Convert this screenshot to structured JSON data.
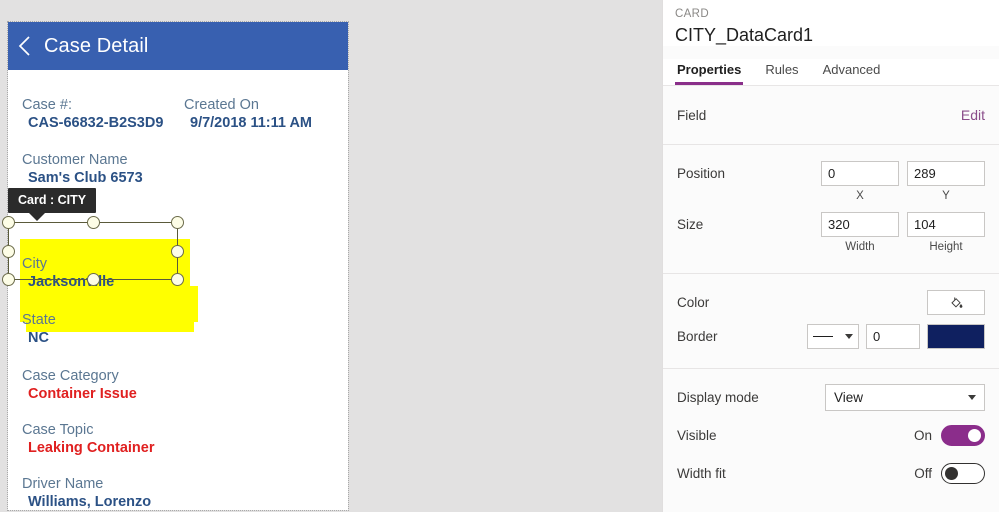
{
  "colors": {
    "header_blue": "#3860b0",
    "accent_purple": "#8a2f8a",
    "highlight_yellow": "#ffff00",
    "label_blue": "#5b7792",
    "value_blue": "#2b5185",
    "value_red": "#e02020",
    "border_swatch": "#0f2060"
  },
  "app": {
    "title": "Case Detail",
    "back_icon": "chevron-left-icon",
    "fields": [
      {
        "label": "Case #:",
        "value": "CAS-66832-B2S3D9",
        "style": "blue"
      },
      {
        "label": "Created On",
        "value": "9/7/2018 11:11 AM",
        "style": "blue"
      },
      {
        "label": "Customer Name",
        "value": "Sam's Club 6573",
        "style": "blue"
      },
      {
        "label": "City",
        "value": "Jacksonville",
        "style": "blue"
      },
      {
        "label": "State",
        "value": "NC",
        "style": "blue"
      },
      {
        "label": "Case Category",
        "value": "Container Issue",
        "style": "red"
      },
      {
        "label": "Case Topic",
        "value": "Leaking Container",
        "style": "red"
      },
      {
        "label": "Driver Name",
        "value": "Williams, Lorenzo",
        "style": "blue"
      }
    ],
    "tooltip": "Card : CITY"
  },
  "panel": {
    "kicker": "CARD",
    "name": "CITY_DataCard1",
    "tabs": [
      {
        "label": "Properties",
        "active": true
      },
      {
        "label": "Rules",
        "active": false
      },
      {
        "label": "Advanced",
        "active": false
      }
    ],
    "field_row": {
      "label": "Field",
      "edit_label": "Edit"
    },
    "position": {
      "label": "Position",
      "x": "0",
      "y": "289",
      "x_caption": "X",
      "y_caption": "Y"
    },
    "size": {
      "label": "Size",
      "width": "320",
      "height": "104",
      "width_caption": "Width",
      "height_caption": "Height"
    },
    "color": {
      "label": "Color",
      "icon": "paint-bucket-icon"
    },
    "border": {
      "label": "Border",
      "style_icon": "solid-line-icon",
      "thickness": "0",
      "swatch": "#0f2060"
    },
    "display_mode": {
      "label": "Display mode",
      "value": "View"
    },
    "visible": {
      "label": "Visible",
      "state": "On"
    },
    "width_fit": {
      "label": "Width fit",
      "state": "Off"
    }
  }
}
